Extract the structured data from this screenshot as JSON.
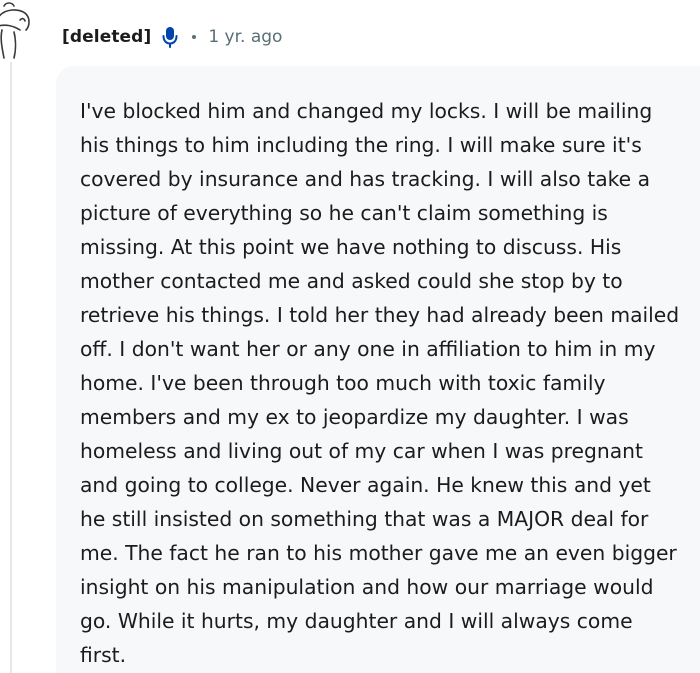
{
  "comment": {
    "author": "[deleted]",
    "separator": "•",
    "timestamp": "1 yr. ago",
    "icons": {
      "avatar": "snoo-avatar-icon",
      "voice": "microphone-icon"
    },
    "colors": {
      "accent_blue": "#0045ac",
      "meta_gray": "#576f76",
      "bubble_bg": "#f6f8f9",
      "text": "#1c1c1c"
    },
    "lines": [
      "I've blocked him and changed my locks. I will be mailing",
      "his things to him including the ring. I will make sure it's",
      "covered by insurance and has tracking. I will also take a",
      "picture of everything so he can't claim something is",
      "missing. At this point we have nothing to discuss. His",
      "mother contacted me and asked could she stop by to",
      "retrieve his things. I told her they had already been mailed",
      "off. I don't want her or any one in affiliation to him in my",
      "home. I've been through too much with toxic family",
      "members and my ex to jeopardize my daughter. I was",
      "homeless and living out of my car when I was pregnant",
      "and going to college. Never again. He knew this and yet",
      "he still insisted on something that was a MAJOR deal for",
      "me. The fact he ran to his mother gave me an even bigger",
      "insight on his manipulation and how our marriage would",
      "go. While it hurts, my daughter and I will always come",
      "first."
    ]
  }
}
